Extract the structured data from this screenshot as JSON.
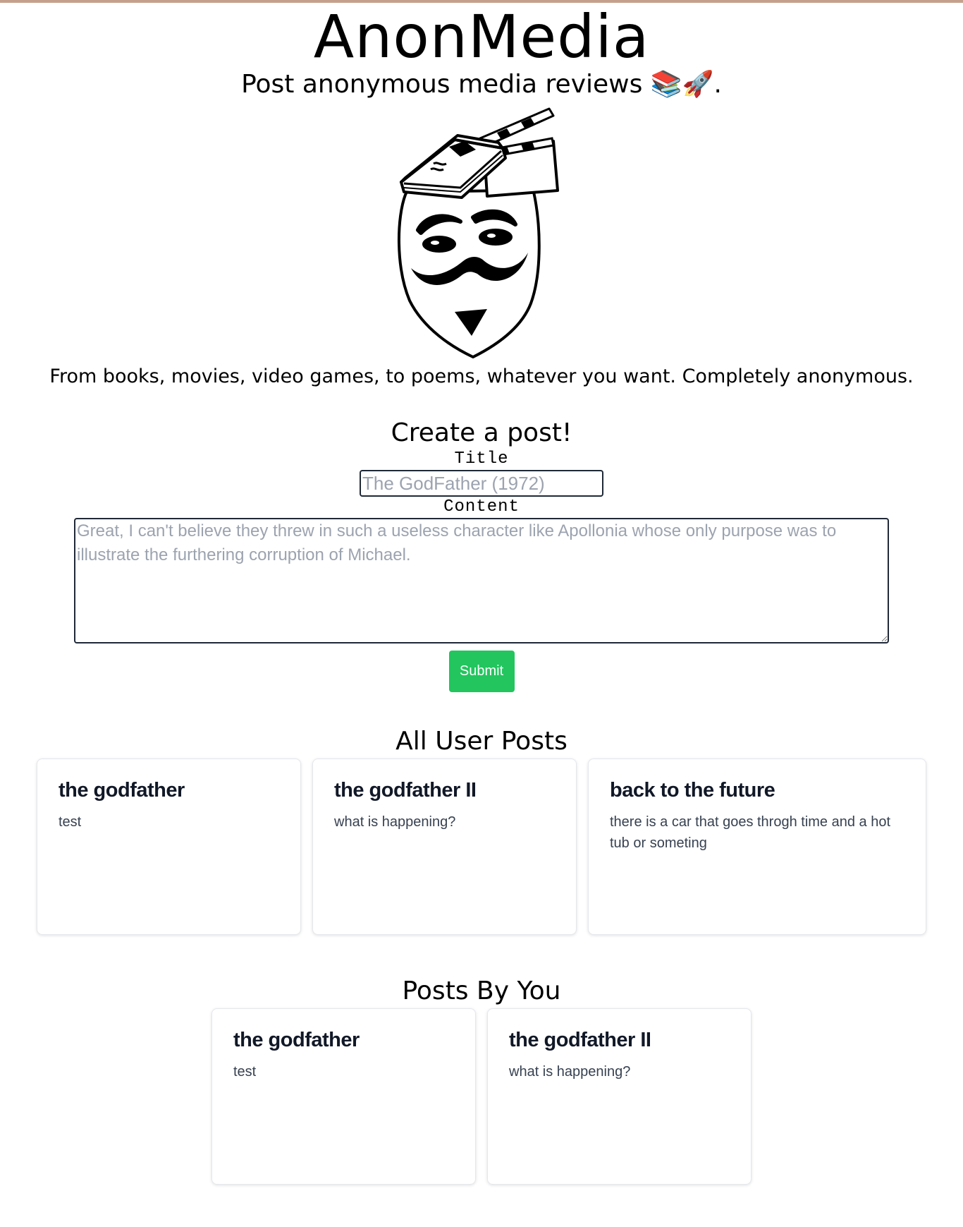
{
  "header": {
    "site_title": "AnonMedia",
    "tagline": "Post anonymous media reviews 📚🚀."
  },
  "logo": {
    "icon": "anonymous-mask-book-clapperboard-logo"
  },
  "intro": {
    "text": "From books, movies, video games, to poems, whatever you want. Completely anonymous."
  },
  "create_post": {
    "heading": "Create a post!",
    "title_label": "Title",
    "title_value": "",
    "title_placeholder": "The GodFather (1972)",
    "content_label": "Content",
    "content_value": "",
    "content_placeholder": "Great, I can't believe they threw in such a useless character like Apollonia whose only purpose was to illustrate the furthering corruption of Michael.",
    "submit_label": "Submit"
  },
  "all_posts": {
    "heading": "All User Posts",
    "posts": [
      {
        "title": "the godfather",
        "content": "test"
      },
      {
        "title": "the godfather II",
        "content": "what is happening?"
      },
      {
        "title": "back to the future",
        "content": "there is a car that goes throgh time and a hot tub or someting"
      }
    ]
  },
  "my_posts": {
    "heading": "Posts By You",
    "posts": [
      {
        "title": "the godfather",
        "content": "test"
      },
      {
        "title": "the godfather II",
        "content": "what is happening?"
      }
    ]
  },
  "colors": {
    "submit_bg": "#22c55e",
    "top_border": "#c4a08c",
    "input_border": "#1f2937",
    "placeholder": "#9ca3af"
  }
}
